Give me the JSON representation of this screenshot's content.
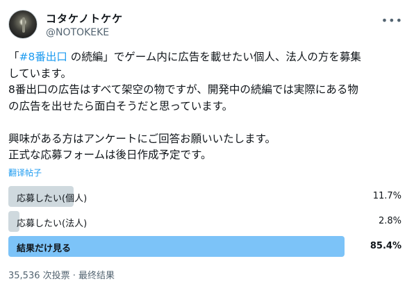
{
  "author": {
    "display_name": "コタケノトケケ",
    "handle": "@NOTOKEKE",
    "more_icon": "more-icon"
  },
  "tweet": {
    "line1_open": "「",
    "line1_hashtag": "#8番出口",
    "line1_rest": " の続編」でゲーム内に広告を載せたい個人、法人の方を募集",
    "line2": "しています。",
    "line3": "8番出口の広告はすべて架空の物ですが、開発中の続編では実際にある物",
    "line4": "の広告を出せたら面白そうだと思っています。",
    "line5": "興味がある方はアンケートにご回答お願いいたします。",
    "line6": "正式な応募フォームは後日作成予定です。",
    "translate_label": "翻译帖子"
  },
  "poll": {
    "options": [
      {
        "label": "応募したい(個人)",
        "percent_text": "11.7%",
        "fraction": 0.117,
        "winner": false
      },
      {
        "label": "応募したい(法人)",
        "percent_text": "2.8%",
        "fraction": 0.028,
        "winner": false
      },
      {
        "label": "結果だけ見る",
        "percent_text": "85.4%",
        "fraction": 0.854,
        "winner": true
      }
    ],
    "votes_text": "35,536 次投票",
    "separator": "·",
    "status_text": "最终结果"
  },
  "colors": {
    "bar": "#cfd9de",
    "winner_bar": "#7cc3f8",
    "link": "#1d9bf0",
    "secondary": "#536471"
  }
}
